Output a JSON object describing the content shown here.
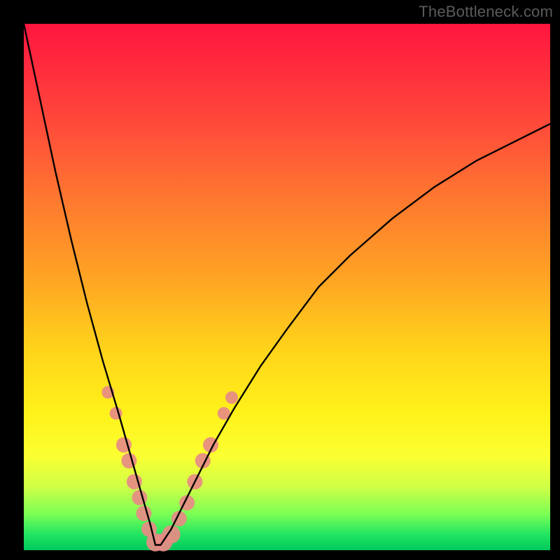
{
  "watermark": "TheBottleneck.com",
  "colors": {
    "curve": "#000000",
    "dots": "#e78b85",
    "frame": "#000000"
  },
  "chart_data": {
    "type": "line",
    "title": "",
    "xlabel": "",
    "ylabel": "",
    "xlim": [
      0,
      100
    ],
    "ylim": [
      0,
      100
    ],
    "grid": false,
    "legend": false,
    "description": "Bottleneck-style V-curve over red→green vertical gradient. Y-axis is inverted visually: low values (good / green) are at the bottom, high values (bad / red) at the top. Curve hits ~0 near x≈25.",
    "series": [
      {
        "name": "curve",
        "x": [
          0,
          3,
          6,
          9,
          12,
          15,
          18,
          20,
          22,
          24,
          25,
          26,
          28,
          30,
          33,
          36,
          40,
          45,
          50,
          56,
          62,
          70,
          78,
          86,
          94,
          100
        ],
        "y": [
          100,
          86,
          72,
          59,
          47,
          36,
          26,
          19,
          12,
          5,
          1,
          1,
          4,
          8,
          14,
          20,
          27,
          35,
          42,
          50,
          56,
          63,
          69,
          74,
          78,
          81
        ]
      }
    ],
    "markers": [
      {
        "x": 16,
        "y": 30
      },
      {
        "x": 17.5,
        "y": 26
      },
      {
        "x": 19,
        "y": 20
      },
      {
        "x": 20,
        "y": 17
      },
      {
        "x": 21,
        "y": 13
      },
      {
        "x": 22,
        "y": 10
      },
      {
        "x": 22.8,
        "y": 7
      },
      {
        "x": 23.8,
        "y": 4
      },
      {
        "x": 25,
        "y": 1.5
      },
      {
        "x": 26.5,
        "y": 1.5
      },
      {
        "x": 28,
        "y": 3
      },
      {
        "x": 29.5,
        "y": 6
      },
      {
        "x": 31,
        "y": 9
      },
      {
        "x": 32.5,
        "y": 13
      },
      {
        "x": 34,
        "y": 17
      },
      {
        "x": 35.5,
        "y": 20
      },
      {
        "x": 38,
        "y": 26
      },
      {
        "x": 39.5,
        "y": 29
      }
    ]
  }
}
